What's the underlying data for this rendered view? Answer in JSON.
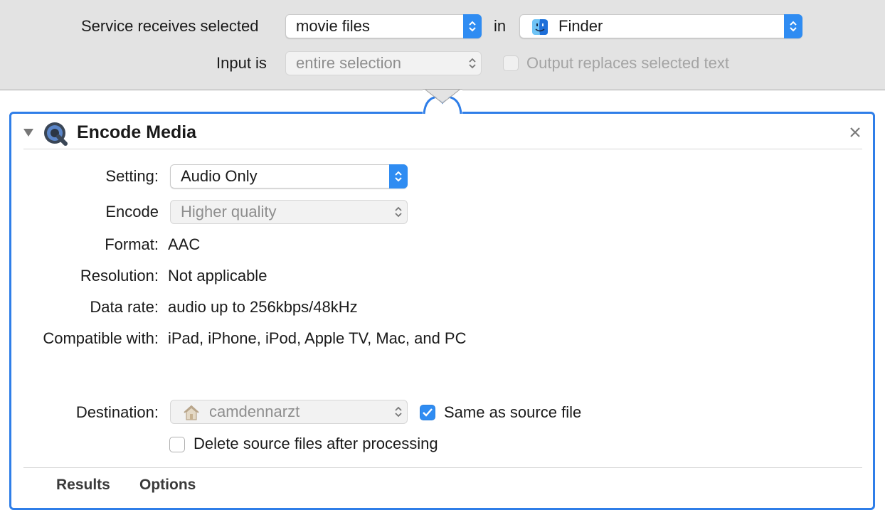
{
  "service": {
    "receives_label": "Service receives selected",
    "receives_value": "movie files",
    "in_label": "in",
    "app_value": "Finder",
    "app_icon": "finder-icon",
    "input_label": "Input is",
    "input_value": "entire selection",
    "output_replaces_label": "Output replaces selected text"
  },
  "action": {
    "title": "Encode Media",
    "icon": "quicktime-icon",
    "setting_label": "Setting:",
    "setting_value": "Audio Only",
    "encode_label": "Encode",
    "encode_value": "Higher quality",
    "format_label": "Format:",
    "format_value": "AAC",
    "resolution_label": "Resolution:",
    "resolution_value": "Not applicable",
    "datarate_label": "Data rate:",
    "datarate_value": "audio up to 256kbps/48kHz",
    "compatible_label": "Compatible with:",
    "compatible_value": "iPad, iPhone, iPod, Apple TV, Mac, and PC",
    "destination_label": "Destination:",
    "destination_value": "camdennarzt",
    "destination_icon": "home-folder-icon",
    "same_as_source_label": "Same as source file",
    "same_as_source_checked": true,
    "delete_source_label": "Delete source files after processing",
    "delete_source_checked": false,
    "tabs": [
      "Results",
      "Options"
    ]
  },
  "colors": {
    "accent": "#2f8cf2",
    "panel_border": "#2f7ee8",
    "bar_bg": "#e3e3e3"
  }
}
